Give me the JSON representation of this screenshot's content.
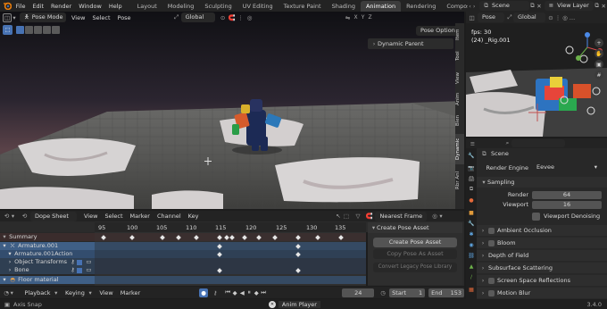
{
  "topbar": {
    "menus": [
      "File",
      "Edit",
      "Render",
      "Window",
      "Help"
    ],
    "workspaces": [
      "Layout",
      "Modeling",
      "Sculpting",
      "UV Editing",
      "Texture Paint",
      "Shading",
      "Animation",
      "Rendering",
      "Composi"
    ],
    "active_workspace": "Animation",
    "scene": "Scene",
    "view_layer": "View Layer"
  },
  "viewport": {
    "mode": "Pose Mode",
    "menus": [
      "View",
      "Select",
      "Pose"
    ],
    "transform": "Global",
    "pose_options": "Pose Options",
    "dynamic_parent": "Dynamic Parent",
    "side_tabs": [
      "Item",
      "Tool",
      "View",
      "Anim",
      "Blen",
      "Dynamic",
      "Rbr Anl"
    ]
  },
  "camera_view": {
    "mode": "Pose",
    "transform": "Global",
    "fps": "fps: 30",
    "object": "(24) _Rig.001"
  },
  "properties": {
    "breadcrumb": "Scene",
    "render_engine_label": "Render Engine",
    "render_engine": "Eevee",
    "sampling": "Sampling",
    "render_label": "Render",
    "render_value": "64",
    "viewport_label": "Viewport",
    "viewport_value": "16",
    "viewport_denoising": "Viewport Denoising",
    "sections": [
      "Ambient Occlusion",
      "Bloom",
      "Depth of Field",
      "Subsurface Scattering",
      "Screen Space Reflections",
      "Motion Blur"
    ]
  },
  "dopesheet": {
    "editor": "Dope Sheet",
    "menus": [
      "View",
      "Select",
      "Marker",
      "Channel",
      "Key"
    ],
    "snap": "Nearest Frame",
    "frame_labels": [
      "95",
      "100",
      "105",
      "110",
      "115",
      "120",
      "125",
      "130",
      "135"
    ],
    "channels": [
      "Summary",
      "Armature.001",
      "Armature.001Action",
      "Object Transforms",
      "Bone",
      "Floor material"
    ],
    "pose_panel_title": "Create Pose Asset",
    "create_pose_asset": "Create Pose Asset",
    "copy_pose_as_asset": "Copy Pose As Asset",
    "convert_legacy": "Convert Legacy Pose Library"
  },
  "timeline": {
    "menus": [
      "Playback",
      "Keying",
      "View",
      "Marker"
    ],
    "current_frame": "24",
    "start_label": "Start",
    "start_value": "1",
    "end_label": "End",
    "end_value": "153"
  },
  "statusbar": {
    "left": "Axis Snap",
    "center": "Anim Player",
    "version": "3.4.0"
  }
}
